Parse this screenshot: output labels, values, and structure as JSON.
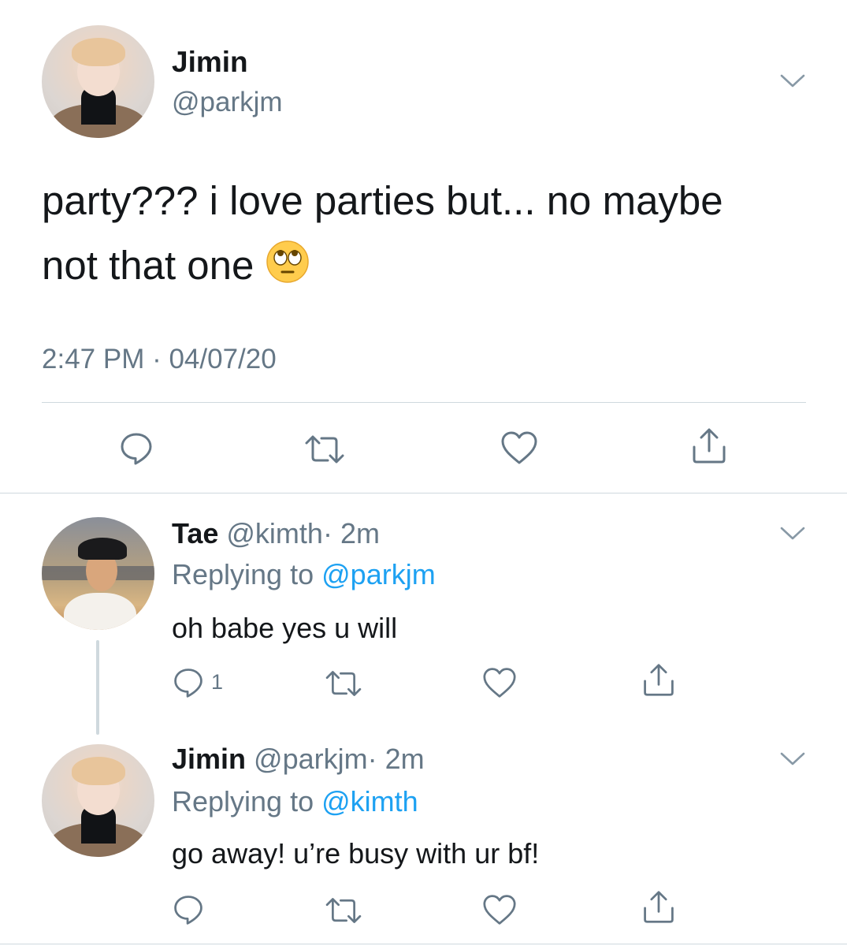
{
  "main_tweet": {
    "name": "Jimin",
    "handle": "@parkjm",
    "text_line1": "party??? i love parties but... no maybe",
    "text_line2": "not that one",
    "emoji_icon": "face-with-rolling-eyes-emoji",
    "timestamp": "2:47 PM · 04/07/20",
    "actions": [
      "reply-icon",
      "retweet-icon",
      "like-icon",
      "share-icon"
    ]
  },
  "replies": [
    {
      "name": "Tae",
      "handle": "@kimth",
      "time": "· 2m",
      "replying_label": "Replying to",
      "replying_to": "@parkjm",
      "text": "oh babe yes u will",
      "reply_count": "1"
    },
    {
      "name": "Jimin",
      "handle": "@parkjm",
      "time": "· 2m",
      "replying_label": "Replying to",
      "replying_to": "@kimth",
      "text": "go away! u’re busy with ur bf!",
      "reply_count": ""
    }
  ],
  "colors": {
    "text": "#14171a",
    "secondary": "#657786",
    "link": "#1da1f2",
    "divider": "#cfd9de"
  }
}
